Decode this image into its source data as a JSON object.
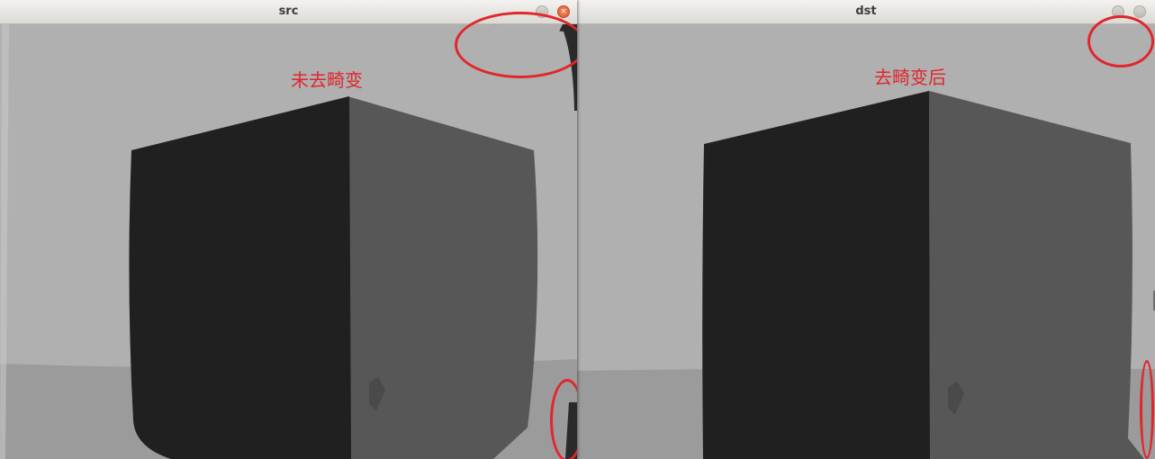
{
  "windows": [
    {
      "id": "src",
      "title": "src",
      "caption": "未去畸变",
      "controls": [
        "minimize-button",
        "close-button"
      ]
    },
    {
      "id": "dst",
      "title": "dst",
      "caption": "去畸变后",
      "controls": [
        "minimize-button",
        "maximize-button"
      ]
    }
  ],
  "colors": {
    "background_wall": "#b0b0b0",
    "floor": "#9b9b9b",
    "box_front": "#202020",
    "box_side": "#575757",
    "annotation_red": "#e1262c",
    "close_button": "#e95a2f"
  }
}
